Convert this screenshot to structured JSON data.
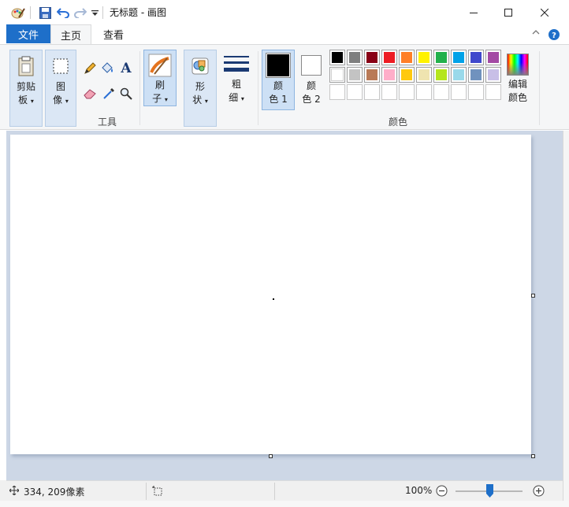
{
  "window": {
    "title": "无标题 - 画图",
    "controls": {
      "minimize": "minimize-icon",
      "maximize": "maximize-icon",
      "close": "close-icon"
    }
  },
  "quick_access": [
    "paint-app-icon",
    "save-icon",
    "undo-icon",
    "redo-icon",
    "customize-dropdown-icon"
  ],
  "tabs": {
    "file": "文件",
    "home": "主页",
    "view": "查看"
  },
  "ribbon": {
    "clipboard": {
      "label_line1": "剪贴",
      "label_line2": "板"
    },
    "image": {
      "label_line1": "图",
      "label_line2": "像"
    },
    "tools": {
      "group_label": "工具",
      "items": [
        "pencil-icon",
        "fill-icon",
        "text-icon",
        "eraser-icon",
        "color-picker-icon",
        "magnifier-icon"
      ]
    },
    "brushes": {
      "label_line1": "刷",
      "label_line2": "子"
    },
    "shapes": {
      "label_line1": "形",
      "label_line2": "状"
    },
    "size": {
      "label_line1": "粗",
      "label_line2": "细"
    },
    "color1": {
      "label_line1": "颜",
      "label_line2": "色 1",
      "color": "#000000"
    },
    "color2": {
      "label_line1": "颜",
      "label_line2": "色 2",
      "color": "#ffffff"
    },
    "colors_group_label": "颜色",
    "edit_colors": {
      "label_line1": "编辑",
      "label_line2": "颜色"
    },
    "palette_row1": [
      "#000000",
      "#7f7f7f",
      "#880015",
      "#ed1c24",
      "#ff7f27",
      "#fff200",
      "#22b14c",
      "#00a2e8",
      "#3f48cc",
      "#a349a4"
    ],
    "palette_row2": [
      "#ffffff",
      "#c3c3c3",
      "#b97a57",
      "#ffaec9",
      "#ffc90e",
      "#efe4b0",
      "#b5e61d",
      "#99d9ea",
      "#7092be",
      "#c8bfe7"
    ],
    "palette_row3": [
      "",
      "",
      "",
      "",
      "",
      "",
      "",
      "",
      "",
      ""
    ]
  },
  "status": {
    "cursor_position": "334, 209像素",
    "zoom": "100%",
    "zoom_fraction": 0.5
  },
  "accent": "#1e6fc9"
}
